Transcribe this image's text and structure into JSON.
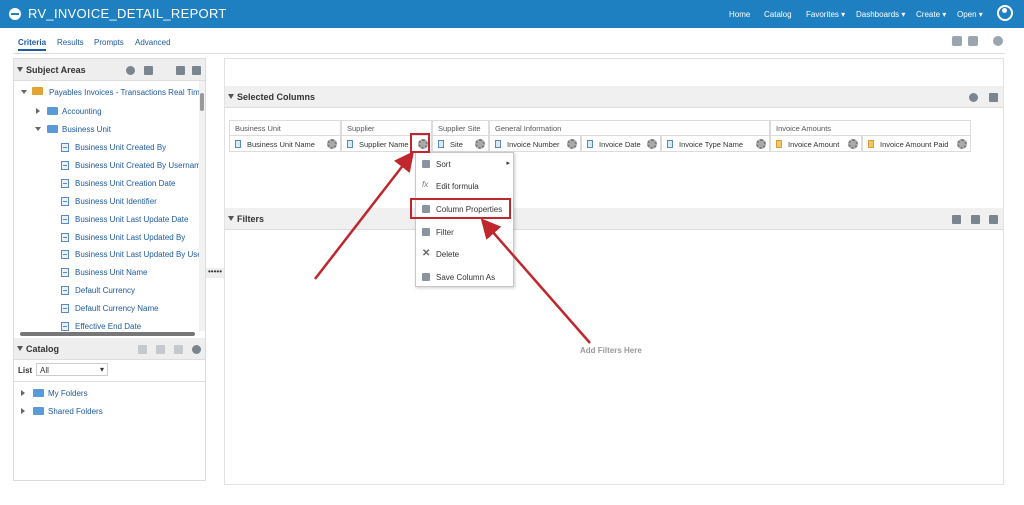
{
  "app": {
    "title": "RV_INVOICE_DETAIL_REPORT",
    "nav": [
      "Home",
      "Catalog",
      "Favorites",
      "Dashboards",
      "Create",
      "Open"
    ]
  },
  "tabs": [
    "Criteria",
    "Results",
    "Prompts",
    "Advanced"
  ],
  "subject_areas": {
    "title": "Subject Areas",
    "root": "Payables Invoices - Transactions Real Tim",
    "folders": [
      "Accounting",
      "Business Unit"
    ],
    "columns": [
      "Business Unit Created By",
      "Business Unit Created By Usernam",
      "Business Unit Creation Date",
      "Business Unit Identifier",
      "Business Unit Last Update Date",
      "Business Unit Last Updated By",
      "Business Unit Last Updated By Use",
      "Business Unit Name",
      "Default Currency",
      "Default Currency Name",
      "Effective End Date"
    ]
  },
  "catalog": {
    "title": "Catalog",
    "list_label": "List",
    "list_value": "All",
    "folders": [
      "My Folders",
      "Shared Folders"
    ]
  },
  "selected_columns": {
    "title": "Selected Columns",
    "groups": [
      "Business Unit",
      "Supplier",
      "Supplier Site",
      "General Information",
      "Invoice Amounts"
    ],
    "columns": [
      "Business Unit Name",
      "Supplier Name",
      "Site",
      "Invoice Number",
      "Invoice Date",
      "Invoice Type Name",
      "Invoice Amount",
      "Invoice Amount Paid"
    ]
  },
  "context_menu": [
    "Sort",
    "Edit formula",
    "Column Properties",
    "Filter",
    "Delete",
    "Save Column As"
  ],
  "filters": {
    "title": "Filters",
    "empty_text": "Add Filters Here"
  },
  "colors": {
    "topbar": "#1e7fc1",
    "highlight": "#c0272d"
  }
}
